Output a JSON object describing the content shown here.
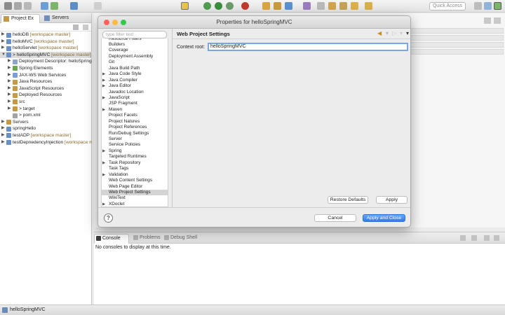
{
  "toolbar": {
    "quick_access": "Quick Access"
  },
  "left_panel": {
    "tabs": [
      "Project Ex",
      "Servers"
    ],
    "tree": [
      {
        "label": "helloDB",
        "annotation": "[workspace master]",
        "level": 0,
        "arrow": "▶"
      },
      {
        "label": "helloMVC",
        "annotation": "[workspace master]",
        "level": 0,
        "arrow": "▶"
      },
      {
        "label": "helloServlet",
        "annotation": "[workspace master]",
        "level": 0,
        "arrow": "▶"
      },
      {
        "label": "> helloSpringMVC",
        "annotation": "[workspace master]",
        "level": 0,
        "arrow": "▼",
        "selected": true
      },
      {
        "label": "Deployment Descriptor: helloSpringMVC",
        "annotation": "",
        "level": 1,
        "arrow": "▶"
      },
      {
        "label": "Spring Elements",
        "annotation": "",
        "level": 1,
        "arrow": "▶"
      },
      {
        "label": "JAX-WS Web Services",
        "annotation": "",
        "level": 1,
        "arrow": "▶"
      },
      {
        "label": "Java Resources",
        "annotation": "",
        "level": 1,
        "arrow": "▶"
      },
      {
        "label": "JavaScript Resources",
        "annotation": "",
        "level": 1,
        "arrow": "▶"
      },
      {
        "label": "Deployed Resources",
        "annotation": "",
        "level": 1,
        "arrow": "▶"
      },
      {
        "label": "src",
        "annotation": "",
        "level": 1,
        "arrow": "▶"
      },
      {
        "label": "> target",
        "annotation": "",
        "level": 1,
        "arrow": "▶"
      },
      {
        "label": "> pom.xml",
        "annotation": "",
        "level": 1,
        "arrow": ""
      },
      {
        "label": "Servers",
        "annotation": "",
        "level": 0,
        "arrow": "▶"
      },
      {
        "label": "springHello",
        "annotation": "",
        "level": 0,
        "arrow": "▶"
      },
      {
        "label": "testADP",
        "annotation": "[workspace master]",
        "level": 0,
        "arrow": "▶"
      },
      {
        "label": "testDepnedencyInjection",
        "annotation": "[workspace master]",
        "level": 0,
        "arrow": "▶"
      }
    ]
  },
  "dialog": {
    "title": "Properties for helloSpringMVC",
    "filter_placeholder": "type filter text",
    "categories": [
      {
        "label": "Resource Filters",
        "arrow": "",
        "partial": true
      },
      {
        "label": "Builders",
        "arrow": ""
      },
      {
        "label": "Coverage",
        "arrow": ""
      },
      {
        "label": "Deployment Assembly",
        "arrow": ""
      },
      {
        "label": "Git",
        "arrow": ""
      },
      {
        "label": "Java Build Path",
        "arrow": ""
      },
      {
        "label": "Java Code Style",
        "arrow": "▶"
      },
      {
        "label": "Java Compiler",
        "arrow": "▶"
      },
      {
        "label": "Java Editor",
        "arrow": "▶"
      },
      {
        "label": "Javadoc Location",
        "arrow": ""
      },
      {
        "label": "JavaScript",
        "arrow": "▶"
      },
      {
        "label": "JSP Fragment",
        "arrow": ""
      },
      {
        "label": "Maven",
        "arrow": "▶"
      },
      {
        "label": "Project Facets",
        "arrow": ""
      },
      {
        "label": "Project Natures",
        "arrow": ""
      },
      {
        "label": "Project References",
        "arrow": ""
      },
      {
        "label": "Run/Debug Settings",
        "arrow": ""
      },
      {
        "label": "Server",
        "arrow": ""
      },
      {
        "label": "Service Policies",
        "arrow": ""
      },
      {
        "label": "Spring",
        "arrow": "▶"
      },
      {
        "label": "Targeted Runtimes",
        "arrow": ""
      },
      {
        "label": "Task Repository",
        "arrow": "▶"
      },
      {
        "label": "Task Tags",
        "arrow": ""
      },
      {
        "label": "Validation",
        "arrow": "▶"
      },
      {
        "label": "Web Content Settings",
        "arrow": ""
      },
      {
        "label": "Web Page Editor",
        "arrow": ""
      },
      {
        "label": "Web Project Settings",
        "arrow": "",
        "selected": true
      },
      {
        "label": "WikiText",
        "arrow": ""
      },
      {
        "label": "XDoclet",
        "arrow": "▶"
      }
    ],
    "page_title": "Web Project Settings",
    "context_root_label": "Context root:",
    "context_root_value": "helloSpringMVC",
    "restore_defaults": "Restore Defaults",
    "apply": "Apply",
    "cancel": "Cancel",
    "apply_and_close": "Apply and Close",
    "help": "?"
  },
  "console": {
    "tabs": [
      "Console",
      "Problems",
      "Debug Shell"
    ],
    "message": "No consoles to display at this time."
  },
  "statusbar": {
    "text": "helloSpringMVC"
  },
  "colors": {
    "accent": "#2f7fe8",
    "close_light": "#fc605c",
    "minimize_light": "#fdbc40",
    "zoom_light": "#34c84a"
  }
}
